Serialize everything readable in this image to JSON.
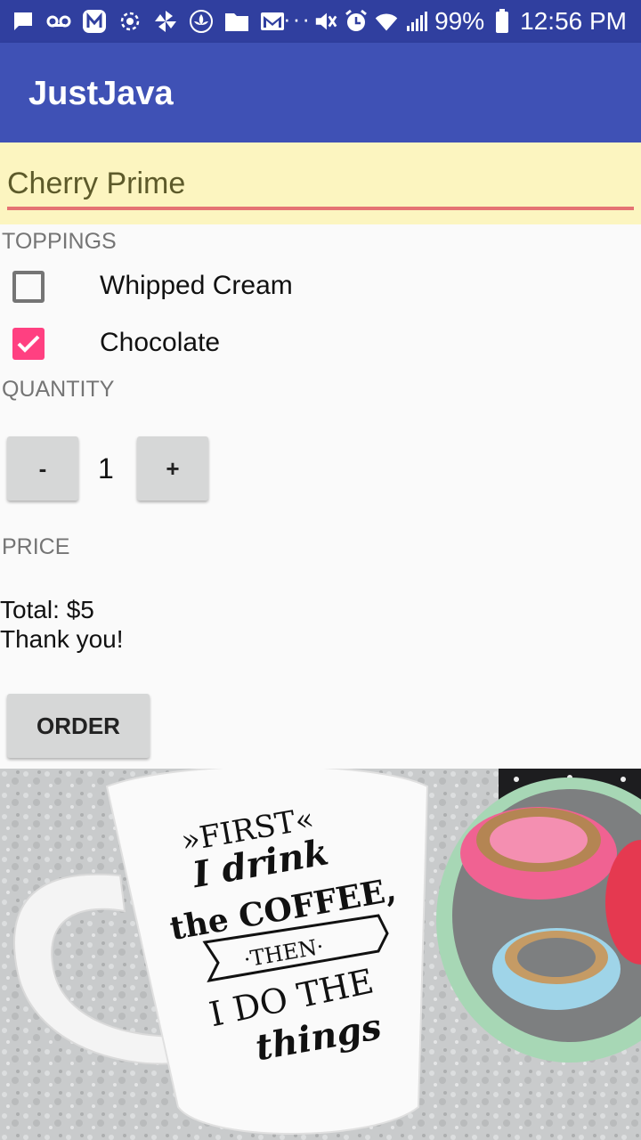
{
  "status_bar": {
    "battery": "99%",
    "time": "12:56 PM",
    "overflow": "···",
    "left_icons": [
      "message-icon",
      "voicemail-icon",
      "m-app-icon",
      "hotspot-icon",
      "pinwheel-icon",
      "lotus-icon",
      "folder-icon",
      "gmail-icon"
    ],
    "right_icons": [
      "mute-icon",
      "alarm-icon",
      "wifi-icon",
      "signal-icon",
      "battery-icon"
    ]
  },
  "app_bar": {
    "title": "JustJava"
  },
  "name_field": {
    "value": "Cherry Prime"
  },
  "toppings": {
    "label": "TOPPINGS",
    "items": [
      {
        "label": "Whipped Cream",
        "checked": false
      },
      {
        "label": "Chocolate",
        "checked": true
      }
    ]
  },
  "quantity": {
    "label": "QUANTITY",
    "decrement_label": "-",
    "value": "1",
    "increment_label": "+"
  },
  "price": {
    "label": "PRICE",
    "total": "Total: $5",
    "thanks": "Thank you!"
  },
  "order": {
    "button_label": "ORDER"
  },
  "photo": {
    "mug_text": [
      "»FIRST«",
      "I drink",
      "the COFFEE,",
      "·THEN·",
      "I DO THE",
      "things"
    ]
  },
  "colors": {
    "status_bar": "#303f9f",
    "app_bar": "#3f51b5",
    "accent": "#ff4081",
    "name_field_bg": "#fcf5c0",
    "underline": "#e57373"
  }
}
